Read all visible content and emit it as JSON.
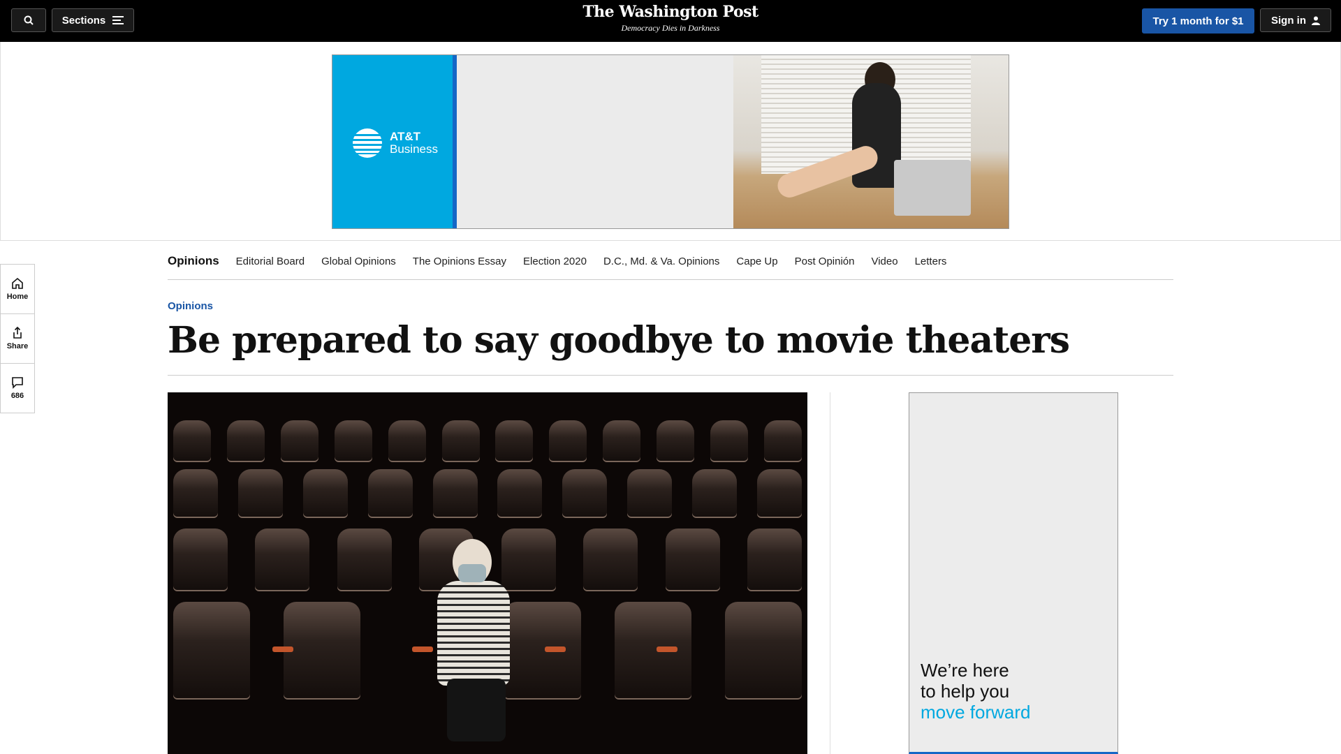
{
  "header": {
    "sections_label": "Sections",
    "logo_name": "The Washington Post",
    "logo_tagline": "Democracy Dies in Darkness",
    "try_label": "Try 1 month for $1",
    "signin_label": "Sign in"
  },
  "top_ad": {
    "brand_line1": "AT&T",
    "brand_line2": "Business"
  },
  "rail": {
    "home_label": "Home",
    "share_label": "Share",
    "comments_count": "686"
  },
  "subnav": {
    "items": [
      "Opinions",
      "Editorial Board",
      "Global Opinions",
      "The Opinions Essay",
      "Election 2020",
      "D.C., Md. & Va. Opinions",
      "Cape Up",
      "Post Opinión",
      "Video",
      "Letters"
    ]
  },
  "article": {
    "kicker": "Opinions",
    "headline": "Be prepared to say goodbye to movie theaters"
  },
  "side_ad": {
    "line1": "We’re here",
    "line2": "to help you",
    "line3": "move forward"
  },
  "colors": {
    "brand_blue": "#1955a5",
    "att_blue": "#00a8e0",
    "topbar": "#000000"
  }
}
